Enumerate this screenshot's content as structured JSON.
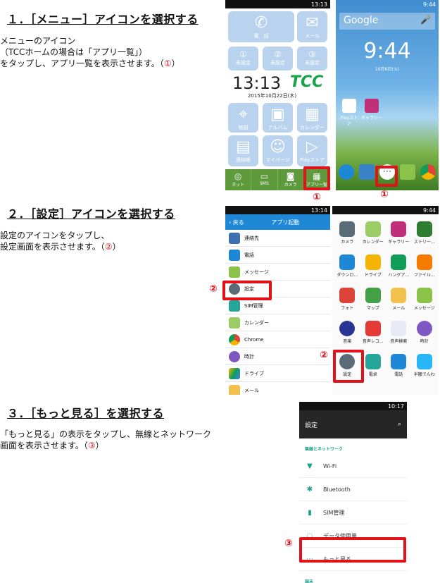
{
  "sections": [
    {
      "title": "１．［メニュー］アイコンを選択する",
      "body": [
        "メニューのアイコン",
        "（TCCホームの場合は「アプリ一覧」）",
        "をタップし、アプリ一覧を表示させます。（"
      ],
      "marker": "①"
    },
    {
      "title": "２．［設定］アイコンを選択する",
      "body": [
        "設定のアイコンをタップし、",
        "設定画面を表示させます。（"
      ],
      "marker": "②"
    },
    {
      "title": "３．［もっと見る］を選択する",
      "body": [
        "「もっと見る」の表示をタップし、無線とネットワーク",
        "画面を表示させます。（"
      ],
      "marker": "③"
    }
  ],
  "phone1": {
    "time": "13:13",
    "clock": "13:13",
    "date": "2015年10月22日(木)",
    "brand": "TCC",
    "top_tiles": [
      "電　話",
      "メール"
    ],
    "speed": [
      {
        "num": "①",
        "label": "未設定"
      },
      {
        "num": "②",
        "label": "未設定"
      },
      {
        "num": "③",
        "label": "未設定"
      }
    ],
    "tiles": [
      "地図",
      "アルバム",
      "カレンダー",
      "連絡帳",
      "マイページ",
      "Playストア"
    ],
    "bottom": [
      "ネット",
      "SMS",
      "カメラ",
      "アプリ一覧"
    ]
  },
  "phone2": {
    "time": "9:44",
    "search": "Google",
    "clock": "9:44",
    "date": "10月6日(火)",
    "apps": [
      "Playストア",
      "ギャラリー"
    ]
  },
  "phone3": {
    "time": "13:14",
    "back": "戻る",
    "title": "アプリ起動",
    "apps": [
      "連絡先",
      "電話",
      "メッセージ",
      "設定",
      "SIM管理",
      "カレンダー",
      "Chrome",
      "時計",
      "ドライブ",
      "メール"
    ]
  },
  "phone4": {
    "time": "9:44",
    "apps": [
      "カメラ",
      "カレンダー",
      "ギャラリー",
      "ストリー...",
      "ダウンロ...",
      "ドライブ",
      "ハングア...",
      "ファイル...",
      "フォト",
      "マップ",
      "メール",
      "メッセージ",
      "音楽",
      "音声レコ...",
      "音声検索",
      "時計",
      "設定",
      "電卓",
      "電話",
      "半額でんわ"
    ]
  },
  "phone5": {
    "time": "10:17",
    "title": "設定",
    "category": "無線とネットワーク",
    "items": [
      "Wi-Fi",
      "Bluetooth",
      "SIM管理",
      "データ使用量",
      "もっと見る"
    ],
    "category2": "端末"
  },
  "colors": {
    "accent": "#e1121a",
    "tile": "#b9d3ee",
    "green": "#5e9a3c",
    "blue": "#1e88d6",
    "teal": "#1aa188"
  }
}
